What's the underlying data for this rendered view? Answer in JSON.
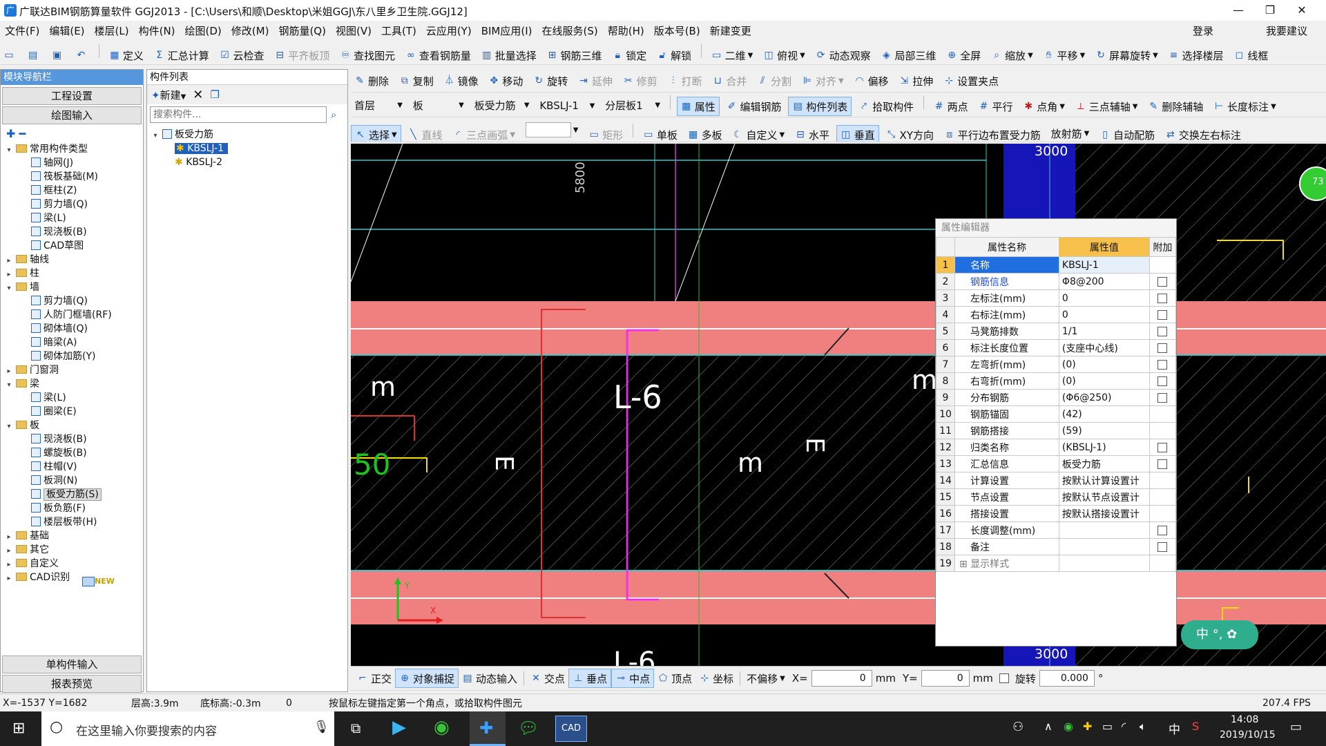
{
  "title": "广联达BIM钢筋算量软件 GGJ2013 - [C:\\Users\\和顺\\Desktop\\米姐GGJ\\东八里乡卫生院.GGJ12]",
  "menu": [
    "文件(F)",
    "编辑(E)",
    "楼层(L)",
    "构件(N)",
    "绘图(D)",
    "修改(M)",
    "钢筋量(Q)",
    "视图(V)",
    "工具(T)",
    "云应用(Y)",
    "BIM应用(I)",
    "在线服务(S)",
    "帮助(H)",
    "版本号(B)",
    "新建变更"
  ],
  "menu_right": {
    "login": "登录",
    "suggest": "我要建议"
  },
  "toolbar1": [
    "定义",
    "汇总计算",
    "云检查",
    "平齐板顶",
    "查找图元",
    "查看钢筋量",
    "批量选择",
    "钢筋三维",
    "锁定",
    "解锁",
    "二维",
    "俯视",
    "动态观察",
    "局部三维",
    "全屏",
    "缩放",
    "平移",
    "屏幕旋转",
    "选择楼层",
    "线框"
  ],
  "left_panel": {
    "title": "模块导航栏",
    "btn_project": "工程设置",
    "btn_draw": "绘图输入",
    "tree": [
      {
        "t": "常用构件类型",
        "lvl": 0,
        "open": true
      },
      {
        "t": "轴网(J)",
        "lvl": 1
      },
      {
        "t": "筏板基础(M)",
        "lvl": 1
      },
      {
        "t": "框柱(Z)",
        "lvl": 1
      },
      {
        "t": "剪力墙(Q)",
        "lvl": 1
      },
      {
        "t": "梁(L)",
        "lvl": 1
      },
      {
        "t": "现浇板(B)",
        "lvl": 1
      },
      {
        "t": "CAD草图",
        "lvl": 1
      },
      {
        "t": "轴线",
        "lvl": 0
      },
      {
        "t": "柱",
        "lvl": 0
      },
      {
        "t": "墙",
        "lvl": 0,
        "open": true
      },
      {
        "t": "剪力墙(Q)",
        "lvl": 1
      },
      {
        "t": "人防门框墙(RF)",
        "lvl": 1
      },
      {
        "t": "砌体墙(Q)",
        "lvl": 1
      },
      {
        "t": "暗梁(A)",
        "lvl": 1
      },
      {
        "t": "砌体加筋(Y)",
        "lvl": 1
      },
      {
        "t": "门窗洞",
        "lvl": 0
      },
      {
        "t": "梁",
        "lvl": 0,
        "open": true
      },
      {
        "t": "梁(L)",
        "lvl": 1
      },
      {
        "t": "圈梁(E)",
        "lvl": 1
      },
      {
        "t": "板",
        "lvl": 0,
        "open": true
      },
      {
        "t": "现浇板(B)",
        "lvl": 1
      },
      {
        "t": "螺旋板(B)",
        "lvl": 1
      },
      {
        "t": "柱帽(V)",
        "lvl": 1
      },
      {
        "t": "板洞(N)",
        "lvl": 1
      },
      {
        "t": "板受力筋(S)",
        "lvl": 1,
        "sel": true
      },
      {
        "t": "板负筋(F)",
        "lvl": 1
      },
      {
        "t": "楼层板带(H)",
        "lvl": 1
      },
      {
        "t": "基础",
        "lvl": 0
      },
      {
        "t": "其它",
        "lvl": 0
      },
      {
        "t": "自定义",
        "lvl": 0
      },
      {
        "t": "CAD识别",
        "lvl": 0
      }
    ],
    "new_badge": "NEW",
    "btn_single": "单构件输入",
    "btn_report": "报表预览"
  },
  "comp_list": {
    "title": "构件列表",
    "new": "新建",
    "search_placeholder": "搜索构件...",
    "root": "板受力筋",
    "items": [
      "KBSLJ-1",
      "KBSLJ-2"
    ]
  },
  "toolbar2": [
    "删除",
    "复制",
    "镜像",
    "移动",
    "旋转",
    "延伸",
    "修剪",
    "打断",
    "合并",
    "分割",
    "对齐",
    "偏移",
    "拉伸",
    "设置夹点"
  ],
  "toolbar3": {
    "floor": "首层",
    "type": "板",
    "sub": "板受力筋",
    "comp": "KBSLJ-1",
    "layer": "分层板1",
    "items": [
      "属性",
      "编辑钢筋",
      "构件列表",
      "拾取构件",
      "两点",
      "平行",
      "点角",
      "三点辅轴",
      "删除辅轴",
      "长度标注"
    ]
  },
  "toolbar4": [
    "选择",
    "直线",
    "三点画弧",
    "矩形",
    "单板",
    "多板",
    "自定义",
    "水平",
    "垂直",
    "XY方向",
    "平行边布置受力筋",
    "放射筋",
    "自动配筋",
    "交换左右标注"
  ],
  "canvas": {
    "dim_top": "5800",
    "dim_right_top": "3000",
    "dim_right_bottom": "3000",
    "label_l6": "L-6",
    "label_l6b": "L-6",
    "m1": "m",
    "m2": "m",
    "m3": "m",
    "e1": "E",
    "e2": "E",
    "num50": "50",
    "badge": "73"
  },
  "props": {
    "title": "属性编辑器",
    "col_name": "属性名称",
    "col_val": "属性值",
    "col_add": "附加",
    "rows": [
      {
        "no": "1",
        "name": "名称",
        "val": "KBSLJ-1",
        "cb": false,
        "sel": true
      },
      {
        "no": "2",
        "name": "钢筋信息",
        "val": "Φ8@200",
        "cb": true,
        "blue": true
      },
      {
        "no": "3",
        "name": "左标注(mm)",
        "val": "0",
        "cb": true
      },
      {
        "no": "4",
        "name": "右标注(mm)",
        "val": "0",
        "cb": true
      },
      {
        "no": "5",
        "name": "马凳筋排数",
        "val": "1/1",
        "cb": true
      },
      {
        "no": "6",
        "name": "标注长度位置",
        "val": "(支座中心线)",
        "cb": true
      },
      {
        "no": "7",
        "name": "左弯折(mm)",
        "val": "(0)",
        "cb": true
      },
      {
        "no": "8",
        "name": "右弯折(mm)",
        "val": "(0)",
        "cb": true
      },
      {
        "no": "9",
        "name": "分布钢筋",
        "val": "(Φ6@250)",
        "cb": true
      },
      {
        "no": "10",
        "name": "钢筋锚固",
        "val": "(42)",
        "cb": false
      },
      {
        "no": "11",
        "name": "钢筋搭接",
        "val": "(59)",
        "cb": false
      },
      {
        "no": "12",
        "name": "归类名称",
        "val": "(KBSLJ-1)",
        "cb": true
      },
      {
        "no": "13",
        "name": "汇总信息",
        "val": "板受力筋",
        "cb": true
      },
      {
        "no": "14",
        "name": "计算设置",
        "val": "按默认计算设置计",
        "cb": false
      },
      {
        "no": "15",
        "name": "节点设置",
        "val": "按默认节点设置计",
        "cb": false
      },
      {
        "no": "16",
        "name": "搭接设置",
        "val": "按默认搭接设置计",
        "cb": false
      },
      {
        "no": "17",
        "name": "长度调整(mm)",
        "val": "",
        "cb": true
      },
      {
        "no": "18",
        "name": "备注",
        "val": "",
        "cb": true
      },
      {
        "no": "19",
        "name": "显示样式",
        "val": "",
        "cb": false,
        "expand": true
      }
    ]
  },
  "snapbar": {
    "items": [
      "正交",
      "对象捕捉",
      "动态输入",
      "交点",
      "垂点",
      "中点",
      "顶点",
      "坐标"
    ],
    "offset": "不偏移",
    "x_label": "X=",
    "x_val": "0",
    "y_label": "Y=",
    "y_val": "0",
    "unit": "mm",
    "rotate": "旋转",
    "rotate_val": "0.000",
    "deg": "°"
  },
  "status": {
    "coords": "X=-1537 Y=1682",
    "floor_h": "层高:3.9m",
    "base_h": "底标高:-0.3m",
    "zero": "0",
    "hint": "按鼠标左键指定第一个角点，或拾取构件图元",
    "fps": "207.4 FPS"
  },
  "taskbar": {
    "search": "在这里输入你要搜索的内容",
    "time": "14:08",
    "date": "2019/10/15",
    "ime": "中"
  },
  "ime_widget": "中"
}
